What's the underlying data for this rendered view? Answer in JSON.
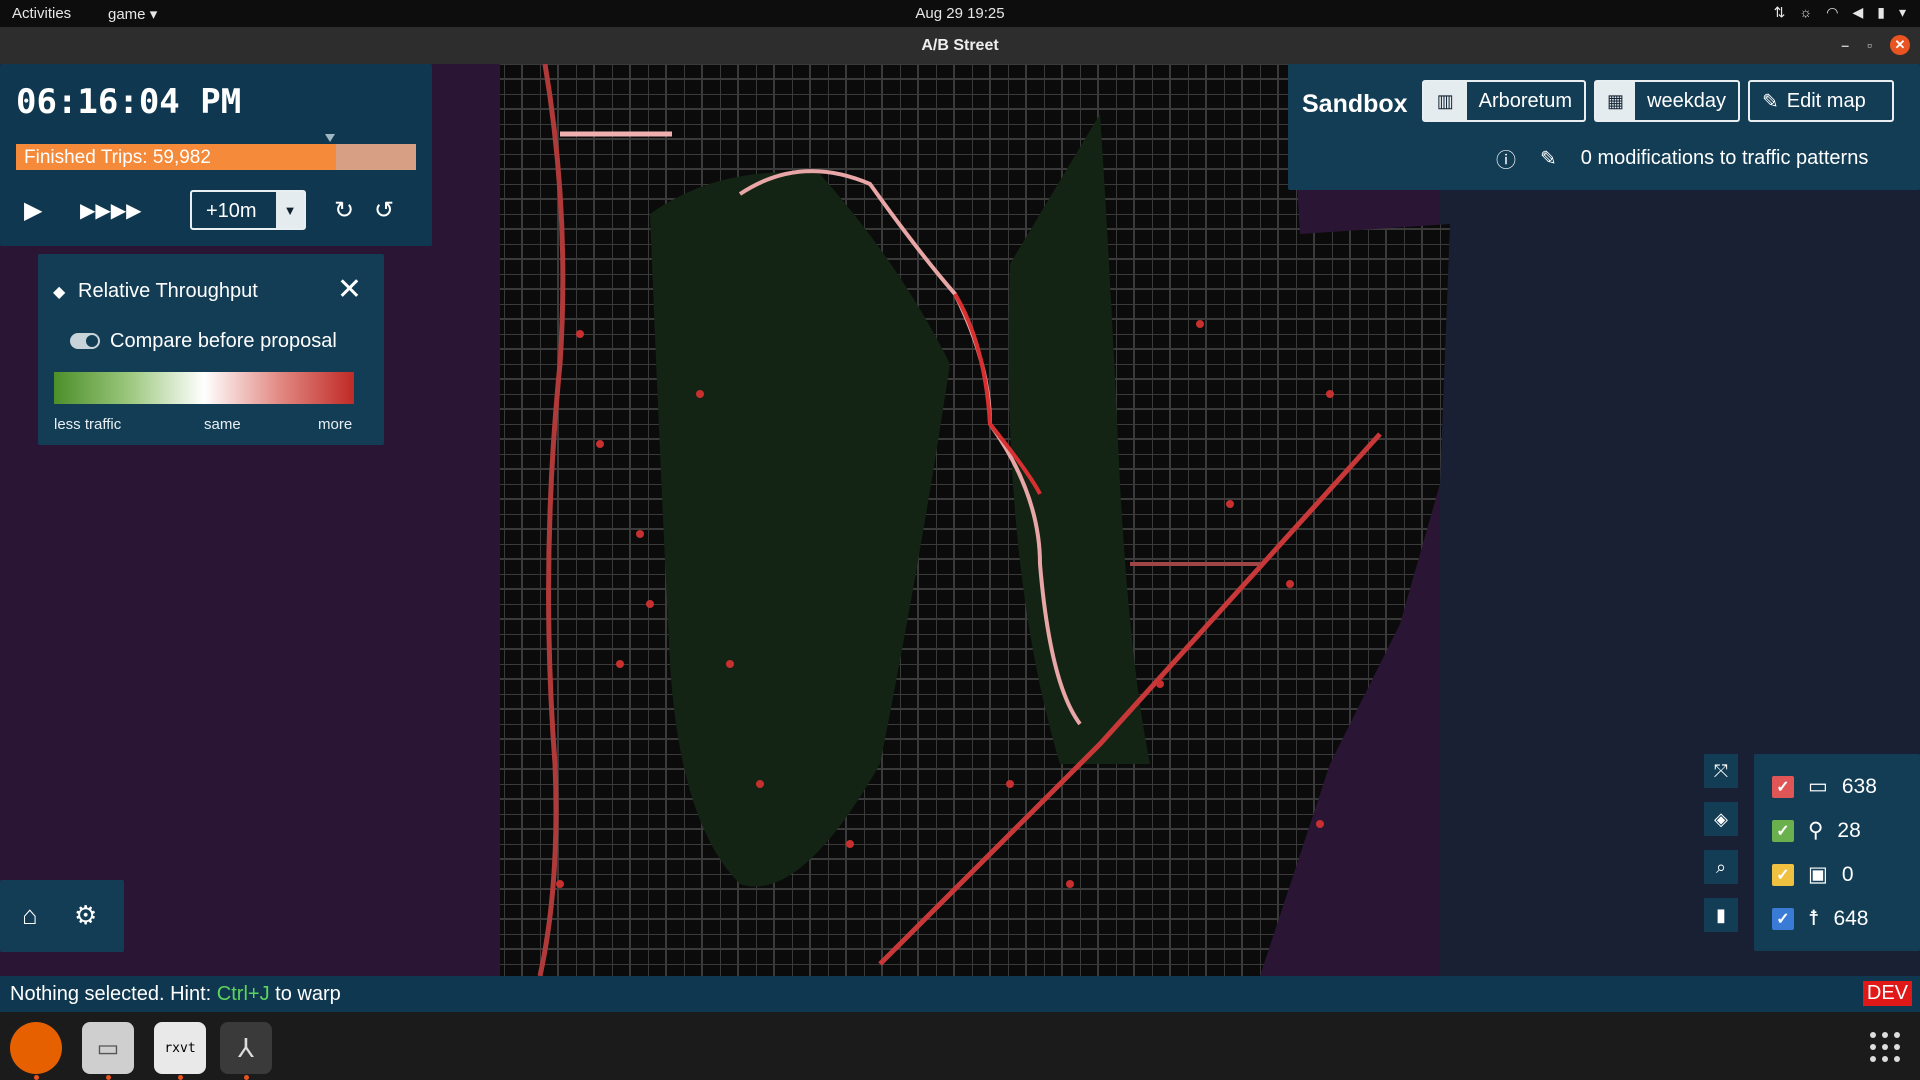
{
  "topbar": {
    "activities": "Activities",
    "app_menu": "game ▾",
    "clock": "Aug 29  19:25",
    "tray_icons": [
      "dropbox-icon",
      "brightness-icon",
      "wifi-icon",
      "volume-icon",
      "battery-icon",
      "menu-arrow-icon"
    ]
  },
  "window": {
    "title": "A/B Street",
    "controls": [
      "–",
      "▫",
      "✕"
    ]
  },
  "time_panel": {
    "time": "06:16:04 PM",
    "finished_trips_label": "Finished Trips: 59,982",
    "progress_fraction": 0.8,
    "step_value": "+10m"
  },
  "legend_panel": {
    "title": "Relative Throughput",
    "toggle_label": "on",
    "compare_label": "Compare before proposal",
    "gradient_labels": [
      "less traffic",
      "same",
      "more"
    ]
  },
  "sandbox": {
    "title": "Sandbox",
    "map_button": "Arboretum",
    "scenario_button": "weekday",
    "edit_button": "Edit map",
    "modifications": "0 modifications to traffic patterns"
  },
  "agents": [
    {
      "icon": "car-icon",
      "count": "638",
      "color": "#e05555"
    },
    {
      "icon": "bike-icon",
      "count": "28",
      "color": "#6ab04c"
    },
    {
      "icon": "bus-icon",
      "count": "0",
      "color": "#f0c040"
    },
    {
      "icon": "pedestrian-icon",
      "count": "648",
      "color": "#3a7bd5"
    }
  ],
  "status_bar": {
    "prefix": "Nothing selected. Hint: ",
    "hotkey": "Ctrl+J",
    "suffix": " to warp",
    "dev_badge": "DEV"
  },
  "dock": {
    "apps": [
      "firefox-icon",
      "files-icon",
      "terminal-icon",
      "abstreet-icon"
    ],
    "terminal_label": "rxvt"
  },
  "colors": {
    "panel": "#123d55",
    "progress_fill": "#f58a3a",
    "progress_bg": "#d79f84",
    "accent": "#e95420"
  }
}
